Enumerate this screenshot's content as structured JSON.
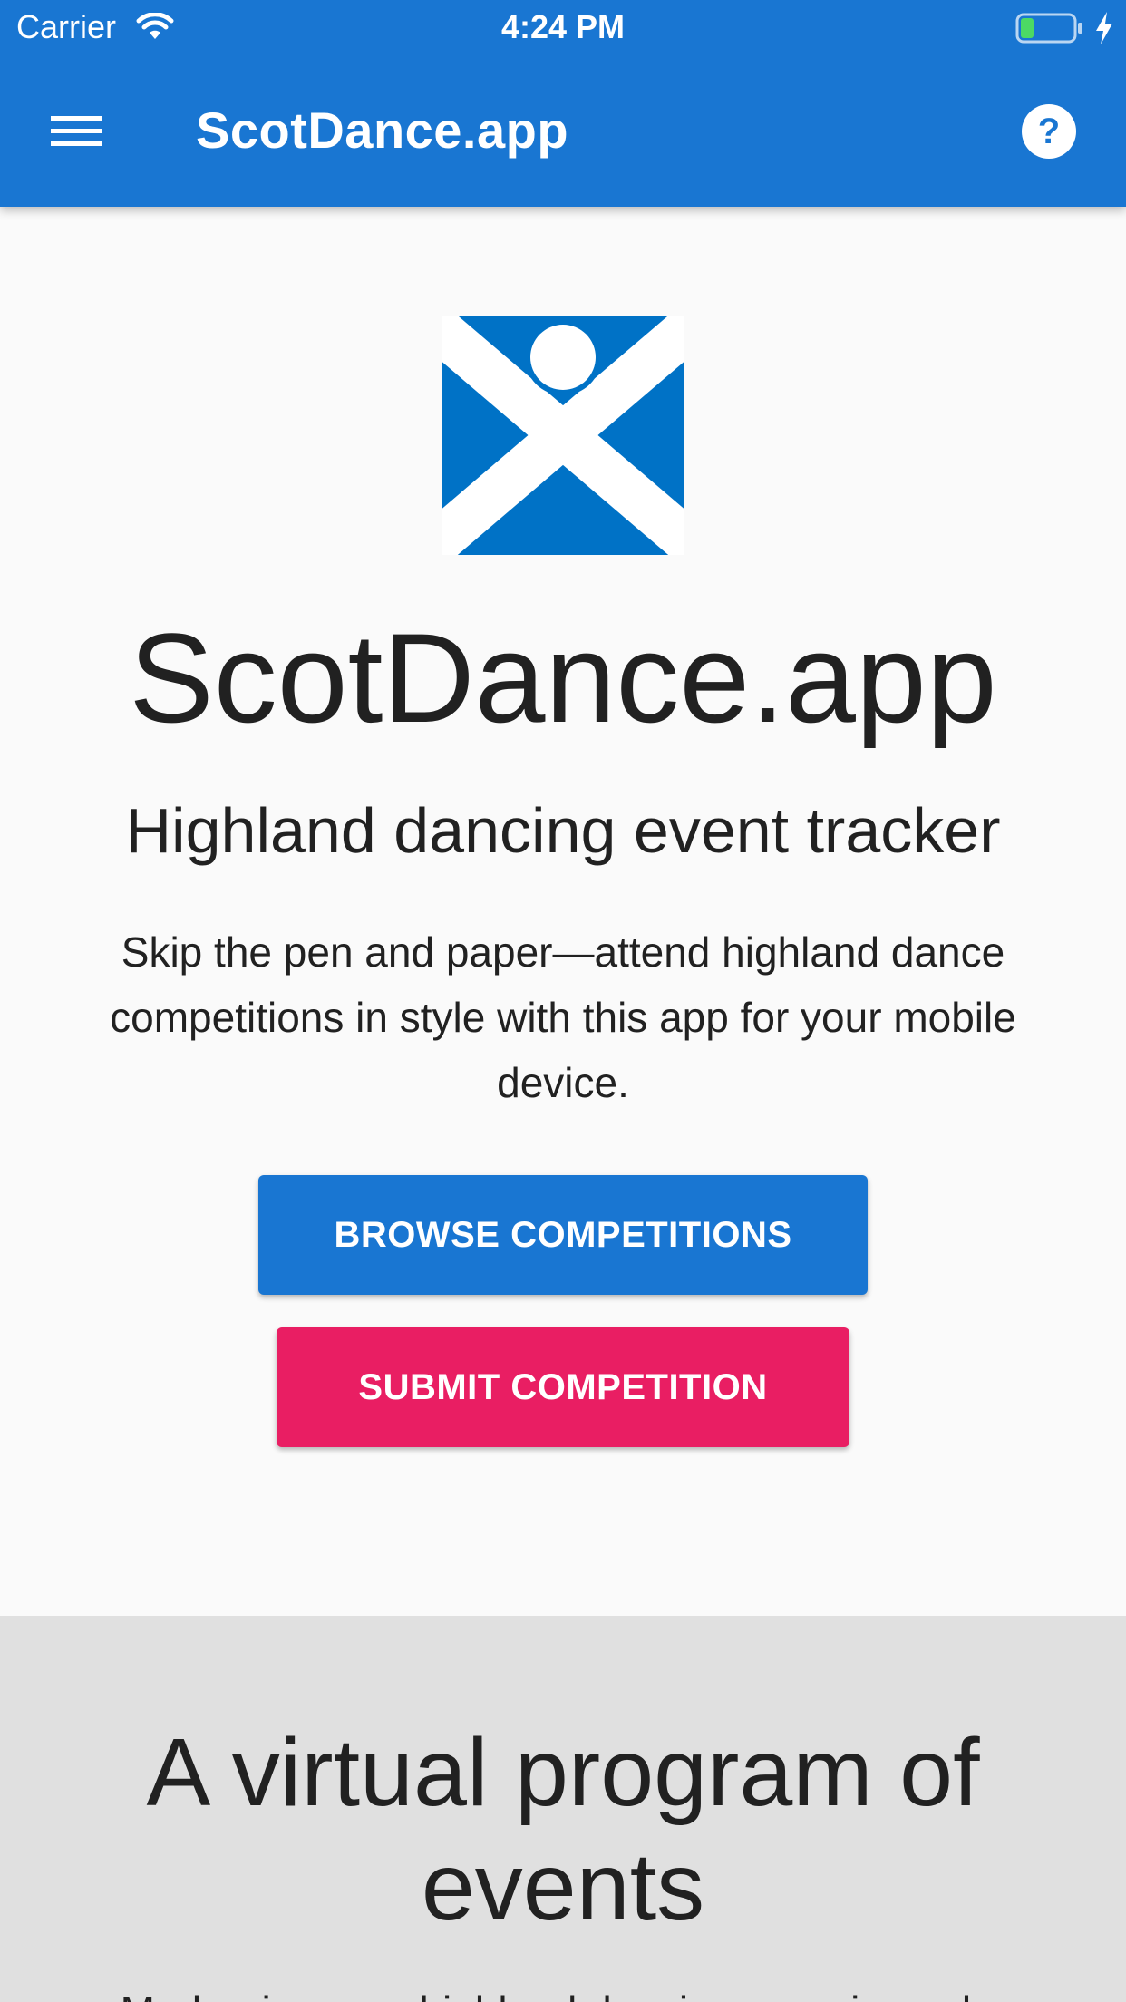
{
  "status_bar": {
    "carrier": "Carrier",
    "time": "4:24 PM",
    "icons": [
      "wifi-icon",
      "battery-icon",
      "charging-bolt-icon"
    ],
    "battery_level": 0.25
  },
  "app_bar": {
    "title": "ScotDance.app",
    "left_icon": "menu-icon",
    "right_icon": "help-icon",
    "background": "#1976d2"
  },
  "hero": {
    "logo": "saltire-dancer-logo",
    "title": "ScotDance.app",
    "subtitle": "Highland dancing event tracker",
    "description": "Skip the pen and paper—attend highland dance competitions in style with this app for your mobile device.",
    "browse_button": "BROWSE COMPETITIONS",
    "submit_button": "SUBMIT COMPETITION"
  },
  "section2": {
    "title": "A virtual program of events",
    "body": "Modernize your highland dancing experience by"
  },
  "colors": {
    "primary": "#1976d2",
    "accent": "#e91e63",
    "logo_blue": "#0072c6",
    "background": "#fafafa",
    "section_background": "#e0e0e0"
  }
}
